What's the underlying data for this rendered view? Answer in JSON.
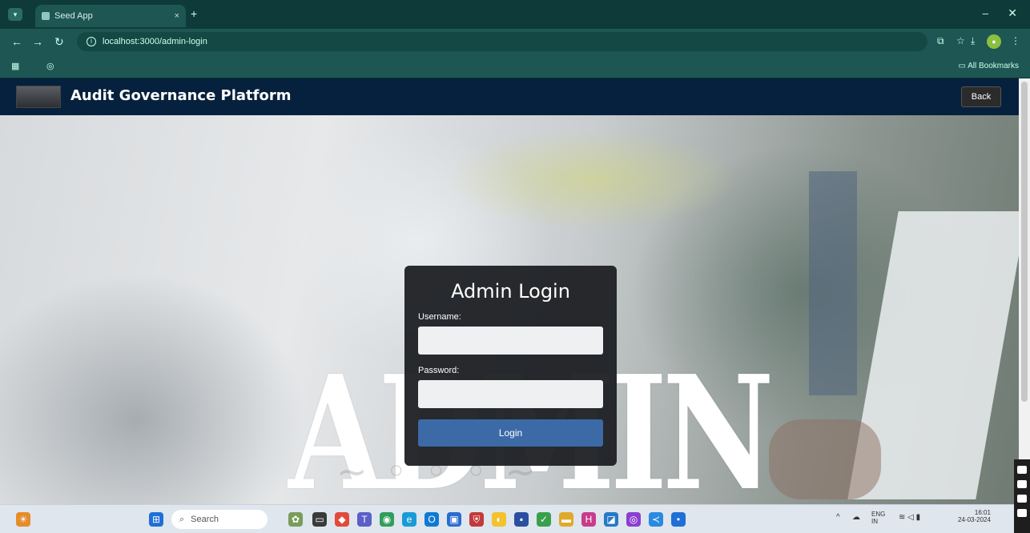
{
  "browser": {
    "tab_title": "Seed App",
    "url": "localhost:3000/admin-login",
    "bookmarks_all_label": "All Bookmarks",
    "new_tab_symbol": "+",
    "close_symbol": "×",
    "minimize_symbol": "–",
    "window_close_symbol": "✕"
  },
  "header": {
    "brand": "Audit Governance Platform",
    "back_label": "Back"
  },
  "hero": {
    "big_text": "ADMIN"
  },
  "login": {
    "title": "Admin Login",
    "username_label": "Username:",
    "username_value": "",
    "password_label": "Password:",
    "password_value": "",
    "button_label": "Login"
  },
  "taskbar": {
    "search_placeholder": "Search",
    "language": "ENG\nIN",
    "time": "16:01",
    "date": "24-03-2024"
  },
  "colors": {
    "header_bg": "#06213d",
    "card_bg": "#1c1e22",
    "button_bg": "#3c6aa6",
    "browser_chrome": "#1d5653"
  },
  "icons": {
    "nav": [
      "back-arrow-icon",
      "forward-arrow-icon",
      "reload-icon",
      "site-info-icon"
    ],
    "taskbar": [
      "windows-start-icon",
      "search-icon",
      "widgets-icon",
      "task-view-icon",
      "chrome-icon",
      "edge-icon",
      "store-icon",
      "teams-icon",
      "vscode-icon",
      "file-explorer-icon"
    ]
  }
}
